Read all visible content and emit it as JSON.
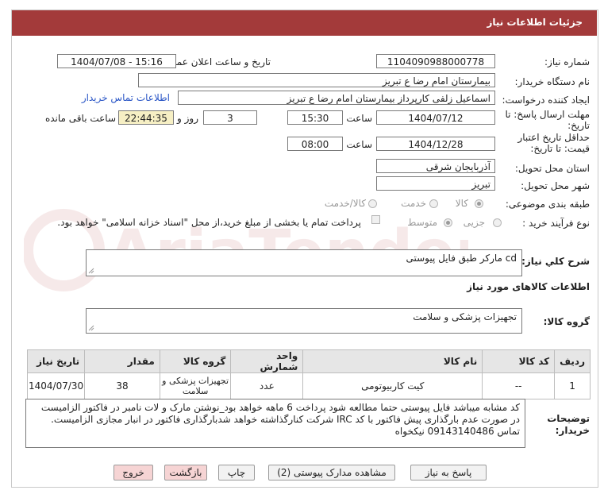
{
  "header": {
    "title": "جزئیات اطلاعات نیاز"
  },
  "fields": {
    "need_number_label": "شماره نیاز:",
    "need_number": "1104090988000778",
    "announce_label": "تاریخ و ساعت اعلان عمومی:",
    "announce_value": "1404/07/08 - 15:16",
    "buyer_org_label": "نام دستگاه خریدار:",
    "buyer_org": "بیمارستان امام رضا  ع  تبریز",
    "requester_label": "ایجاد کننده درخواست:",
    "requester": "اسماعیل زلفی کارپرداز بیمارستان امام رضا  ع  تبریز",
    "contact_link": "اطلاعات تماس خریدار",
    "deadline_label_1": "مهلت ارسال پاسخ: تا",
    "deadline_label_2": "تاریخ:",
    "deadline_date": "1404/07/12",
    "time_word": "ساعت",
    "deadline_time": "15:30",
    "days_value": "3",
    "days_word": "روز و",
    "remaining_time": "22:44:35",
    "remaining_word": "ساعت باقی مانده",
    "validity_label_1": "حداقل تاریخ اعتبار",
    "validity_label_2": "قیمت: تا تاریخ:",
    "validity_date": "1404/12/28",
    "validity_time": "08:00",
    "province_label": "استان محل تحویل:",
    "province": "آذربایجان شرقی",
    "city_label": "شهر محل تحویل:",
    "city": "تبریز",
    "category_label": "طبقه بندی موضوعی:",
    "category_options": [
      "کالا",
      "خدمت",
      "کالا/خدمت"
    ],
    "process_label": "نوع فرآیند خرید :",
    "process_options": [
      "جزیی",
      "متوسط"
    ],
    "payment_note": "پرداخت تمام یا بخشی از مبلغ خرید،از محل \"اسناد خزانه اسلامی\" خواهد بود."
  },
  "summary": {
    "label": "شرح کلي نياز:",
    "value": "cd  مارکر طبق فایل پیوستی"
  },
  "goods_info_title": "اطلاعات کالاهای مورد نیاز",
  "goods_group": {
    "label": "گروه کالا:",
    "value": "تجهیزات پزشکی و سلامت"
  },
  "table": {
    "headers": [
      "ردیف",
      "کد کالا",
      "نام کالا",
      "واحد شمارش",
      "گروه کالا",
      "مقدار",
      "تاریخ نیاز"
    ],
    "rows": [
      {
        "row": "1",
        "code": "--",
        "name": "کیت کاربیوتومی",
        "unit": "عدد",
        "group": "تجهیزات پزشکی و سلامت",
        "qty": "38",
        "date": "1404/07/30"
      }
    ]
  },
  "buyer_notes": {
    "label_1": "توضیحات",
    "label_2": "خریدار:",
    "text": "کد مشابه میباشد فایل پیوستی حتما مطالعه شود  پرداخت 6 ماهه خواهد بود_نوشتن مارک و لات نامبر در فاکتور الزامیست   در صورت عدم بارگذاری پیش فاکتور با کد IRC  شرکت کنارگذاشته خواهد شدبارگذاری فاکتور در انبار مجازی الزامیست. تماس 09143140486 نیکخواه"
  },
  "buttons": {
    "reply": "پاسخ به نیاز",
    "view_docs": "مشاهده مدارک پیوستی (2)",
    "print": "چاپ",
    "back": "بازگشت",
    "exit": "خروج"
  },
  "watermark": {
    "text": "AriaTender.net"
  },
  "colors": {
    "header": "#a33a3a",
    "link": "#2a56c6",
    "remaining_bg": "#f6efc4",
    "button_pink": "#f6d4d4"
  }
}
